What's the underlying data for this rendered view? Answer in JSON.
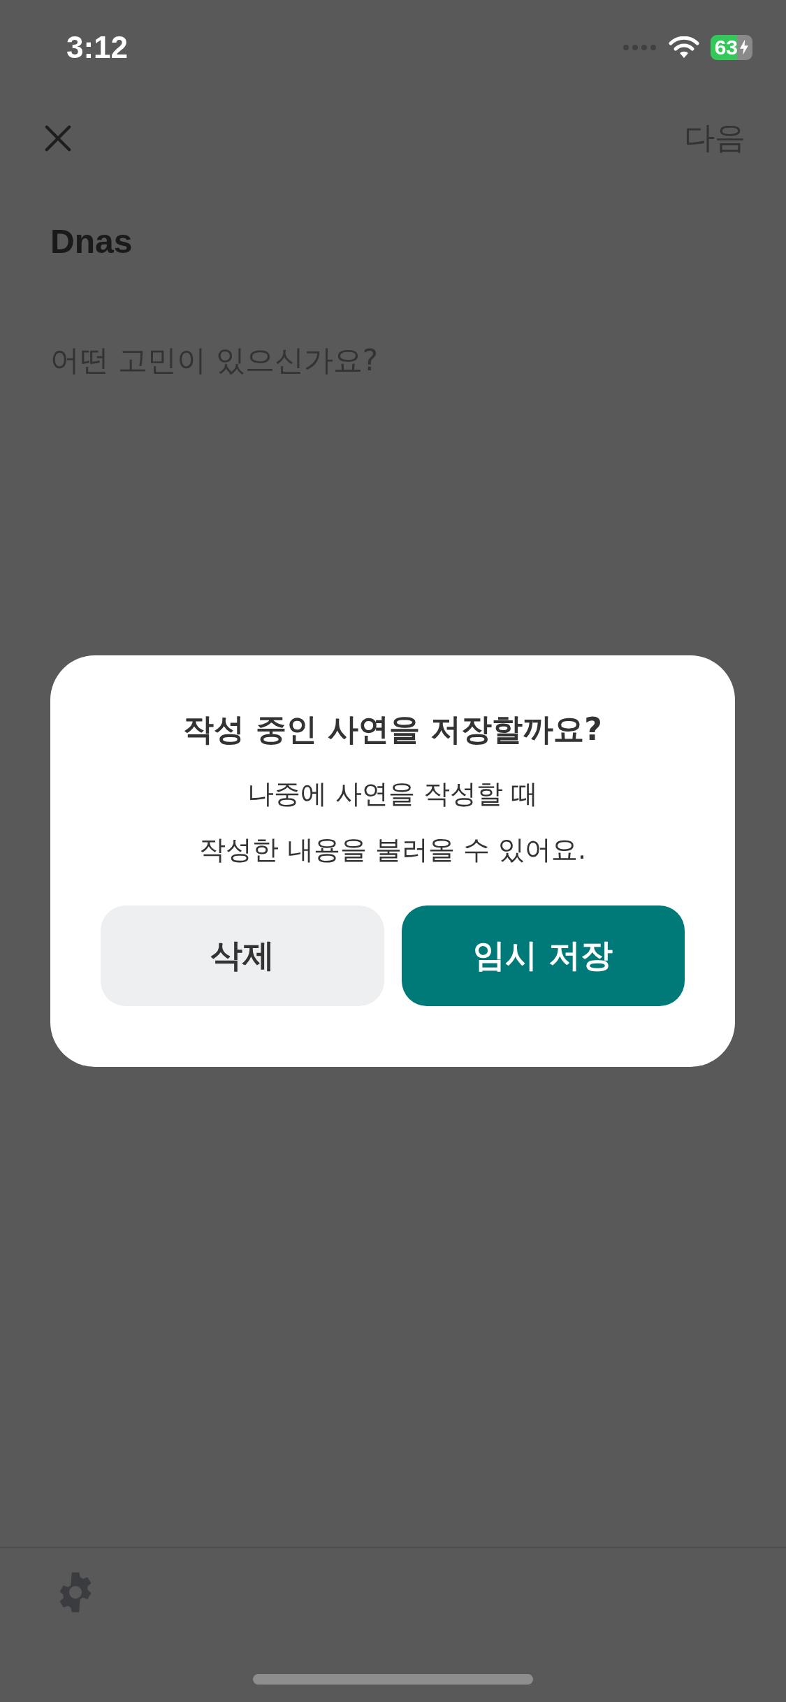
{
  "status_bar": {
    "time": "3:12",
    "battery": "63"
  },
  "nav": {
    "next": {
      "label": "다음",
      "disabled": true
    }
  },
  "author": "Dnas",
  "body_field": {
    "placeholder": "어떤 고민이 있으신가요?"
  },
  "dialog": {
    "title": "작성 중인 사연을 저장할까요?",
    "message": "나중에 사연을 작성할 때\n작성한 내용을 불러올 수 있어요.",
    "buttons": [
      {
        "label": "삭제",
        "kind": "secondary"
      },
      {
        "label": "임시 저장",
        "kind": "primary"
      }
    ]
  }
}
